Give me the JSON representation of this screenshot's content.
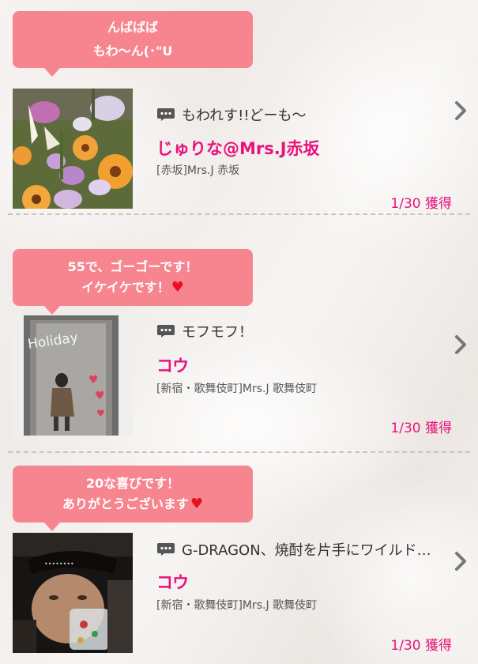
{
  "posts": [
    {
      "bubble_line1": "んばばば",
      "bubble_line2": "もわ〜ん(･\"U",
      "bubble_heart": false,
      "message": "もわれす!!どーも〜",
      "name": "じゅりな@Mrs.J赤坂",
      "shop": "[赤坂]Mrs.J 赤坂",
      "count": "1/30 獲得",
      "thumb_icon": "flower-bouquet-photo"
    },
    {
      "bubble_line1": "55で、ゴーゴーです！",
      "bubble_line2": "イケイケです！",
      "bubble_heart": true,
      "message": "モフモフ！",
      "name": "コウ",
      "shop": "[新宿・歌舞伎町]Mrs.J 歌舞伎町",
      "count": "1/30 獲得",
      "thumb_icon": "holiday-mirror-photo",
      "thumb_text": "Holiday"
    },
    {
      "bubble_line1": "20な喜びです！",
      "bubble_line2": "ありがとうございます",
      "bubble_heart": true,
      "message": "G-DRAGON、焼酎を片手にワイルド…",
      "name": "コウ",
      "shop": "[新宿・歌舞伎町]Mrs.J 歌舞伎町",
      "count": "1/30 獲得",
      "thumb_icon": "person-with-glass-photo"
    }
  ],
  "colors": {
    "bubble": "#f6858f",
    "accent": "#e8137c",
    "heart": "#e8121e"
  },
  "icons": {
    "message": "speech-bubble-icon",
    "chevron": "chevron-right-icon",
    "heart": "heart-icon"
  }
}
